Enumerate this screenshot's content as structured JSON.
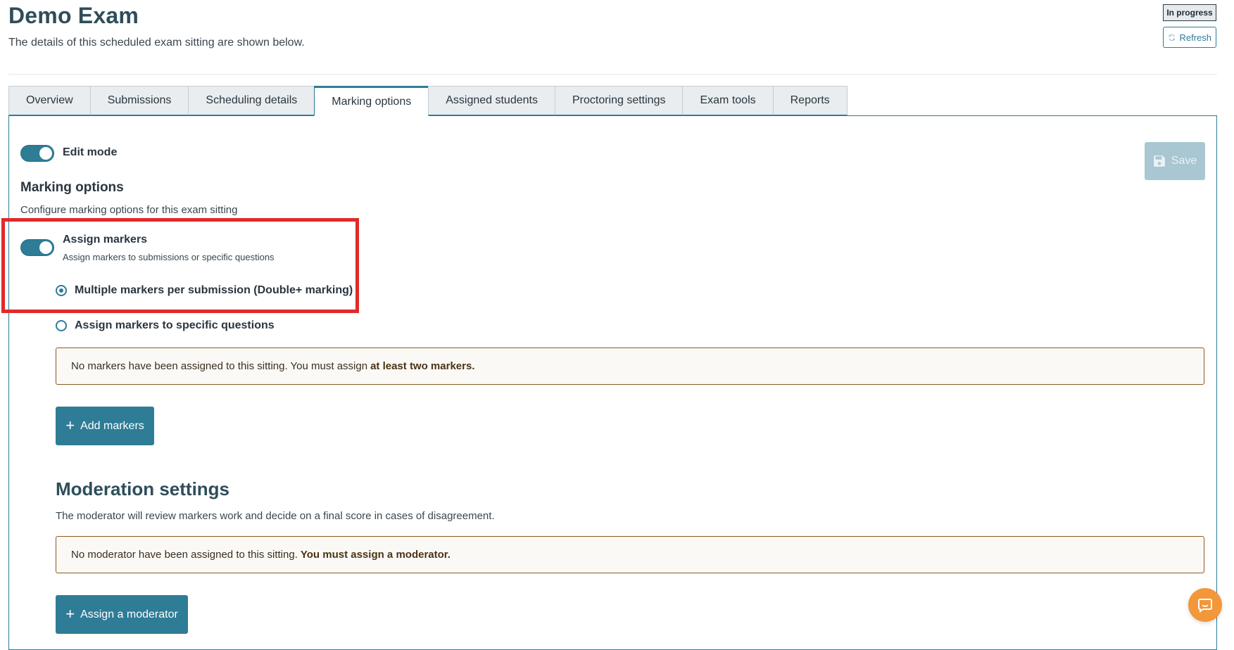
{
  "header": {
    "title": "Demo Exam",
    "subtitle": "The details of this scheduled exam sitting are shown below.",
    "status_badge": "In progress",
    "refresh_label": "Refresh"
  },
  "tabs": [
    {
      "label": "Overview",
      "active": false
    },
    {
      "label": "Submissions",
      "active": false
    },
    {
      "label": "Scheduling details",
      "active": false
    },
    {
      "label": "Marking options",
      "active": true
    },
    {
      "label": "Assigned students",
      "active": false
    },
    {
      "label": "Proctoring settings",
      "active": false
    },
    {
      "label": "Exam tools",
      "active": false
    },
    {
      "label": "Reports",
      "active": false
    }
  ],
  "edit_mode": {
    "label": "Edit mode",
    "on": true
  },
  "save_label": "Save",
  "marking": {
    "title": "Marking options",
    "description": "Configure marking options for this exam sitting",
    "assign_markers": {
      "on": true,
      "title": "Assign markers",
      "description": "Assign markers to submissions or specific questions"
    },
    "options": [
      {
        "label": "Multiple markers per submission (Double+ marking)",
        "selected": true
      },
      {
        "label": "Assign markers to specific questions",
        "selected": false
      }
    ],
    "notice_text": "No markers have been assigned to this sitting. You must assign",
    "notice_strong": "at least two markers.",
    "add_markers_label": "Add markers"
  },
  "moderation": {
    "title": "Moderation settings",
    "description": "The moderator will review markers work and decide on a final score in cases of disagreement.",
    "notice_text": "No moderator have been assigned to this sitting.",
    "notice_strong": "You must assign a moderator.",
    "assign_label": "Assign a moderator"
  },
  "colors": {
    "accent": "#2e7c96",
    "highlight": "#e12a2a",
    "chat": "#f2973a"
  }
}
